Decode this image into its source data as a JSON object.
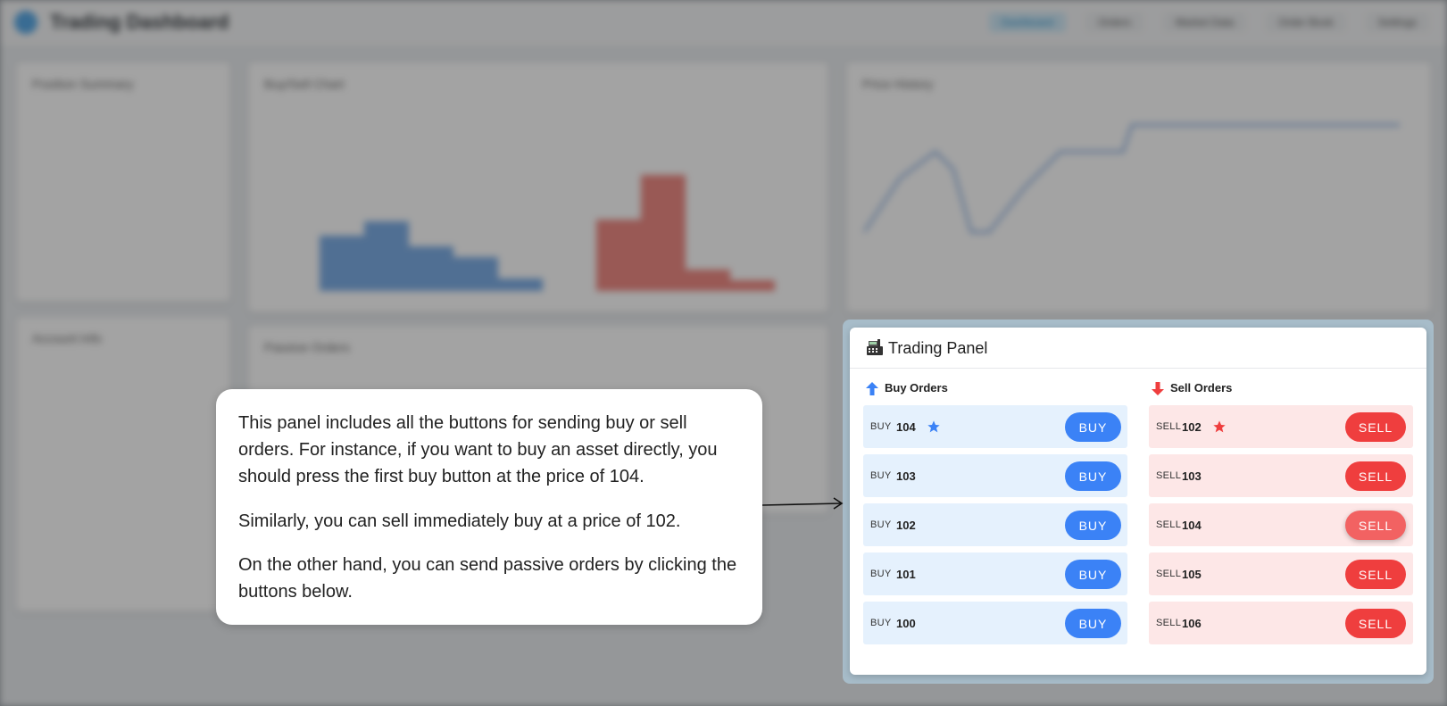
{
  "app": {
    "title": "Trading Dashboard"
  },
  "nav": {
    "items": [
      "Dashboard",
      "Orders",
      "Market Data",
      "Order Book",
      "Settings"
    ]
  },
  "background_cards": {
    "position_summary": "Position Summary",
    "buy_sell_chart": "Buy/Sell Chart",
    "price_history": "Price History",
    "account_info": "Account Info",
    "passive_orders": "Passive Orders"
  },
  "trading_panel": {
    "title": "Trading Panel",
    "buy_column": {
      "title": "Buy Orders",
      "side_label": "BUY",
      "button_label": "BUY",
      "rows": [
        {
          "price": "104",
          "starred": true
        },
        {
          "price": "103",
          "starred": false
        },
        {
          "price": "102",
          "starred": false
        },
        {
          "price": "101",
          "starred": false
        },
        {
          "price": "100",
          "starred": false
        }
      ]
    },
    "sell_column": {
      "title": "Sell Orders",
      "side_label": "SELL",
      "button_label": "SELL",
      "rows": [
        {
          "price": "102",
          "starred": true
        },
        {
          "price": "103",
          "starred": false
        },
        {
          "price": "104",
          "starred": false,
          "hovered": true
        },
        {
          "price": "105",
          "starred": false
        },
        {
          "price": "106",
          "starred": false
        }
      ]
    }
  },
  "tooltip": {
    "paragraph_1": "This panel includes all the buttons for sending buy or sell orders. For instance, if you want to buy an asset directly, you should press the first buy button at the  price of 104.",
    "paragraph_2": "Similarly, you can sell immediately buy at a price of 102.",
    "paragraph_3": "On the other hand, you can send passive orders by clicking the buttons below."
  },
  "colors": {
    "buy_accent": "#3b82f6",
    "sell_accent": "#ef3e3e",
    "buy_row_bg": "#e5f1fd",
    "sell_row_bg": "#fde7e7",
    "star_blue": "#3b82f6",
    "star_red": "#ef3e3e"
  }
}
